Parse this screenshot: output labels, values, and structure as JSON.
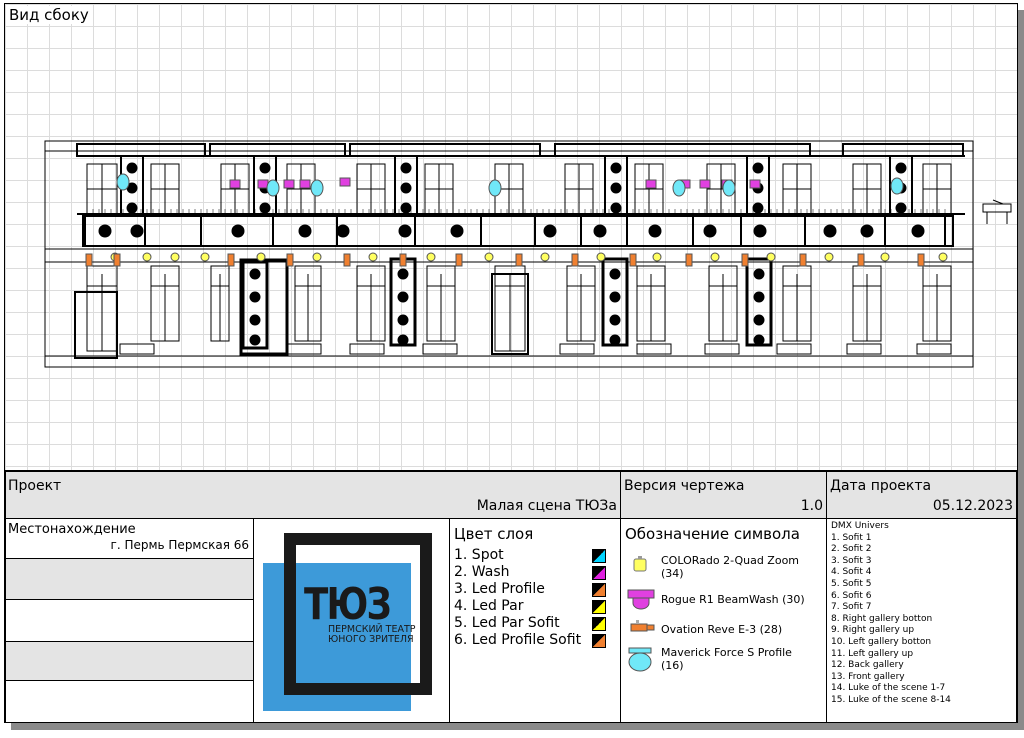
{
  "view_title": "Вид сбоку",
  "title_block": {
    "project_label": "Проект",
    "project_value": "Малая сцена ТЮЗа",
    "version_label": "Версия чертежа",
    "version_value": "1.0",
    "date_label": "Дата проекта",
    "date_value": "05.12.2023",
    "location_label": "Местонахождение",
    "location_value": "г. Пермь Пермская 66"
  },
  "logo": {
    "text": "ТЮЗ",
    "subtitle_line1": "ПЕРМСКИЙ ТЕАТР",
    "subtitle_line2": "ЮНОГО ЗРИТЕЛЯ",
    "blue": "#3d9ad9"
  },
  "layers": {
    "title": "Цвет слоя",
    "items": [
      {
        "label": "1. Spot",
        "color": "#00d4ff"
      },
      {
        "label": "2. Wash",
        "color": "#e020e0"
      },
      {
        "label": "3. Led Profile",
        "color": "#f08030"
      },
      {
        "label": "4. Led Par",
        "color": "#ffff00"
      },
      {
        "label": "5. Led Par Sofit",
        "color": "#ffff00"
      },
      {
        "label": "6. Led Profile Sofit",
        "color": "#f08030"
      }
    ]
  },
  "symbols": {
    "title": "Обозначение символа",
    "items": [
      {
        "label": "COLORado 2-Quad Zoom (34)",
        "icon": "led-par-icon",
        "color": "#ffff60"
      },
      {
        "label": "Rogue R1 BeamWash (30)",
        "icon": "beamwash-icon",
        "color": "#e040e0"
      },
      {
        "label": "Ovation Reve E-3 (28)",
        "icon": "led-profile-icon",
        "color": "#f08030"
      },
      {
        "label": "Maverick Force S Profile (16)",
        "icon": "spot-profile-icon",
        "color": "#70e8f8"
      }
    ]
  },
  "dmx": {
    "title": "DMX Univers",
    "items": [
      "1. Sofit 1",
      "2. Sofit 2",
      "3. Sofit 3",
      "4. Sofit 4",
      "5. Sofit 5",
      "6. Sofit 6",
      "7. Sofit 7",
      "8. Right gallery botton",
      "9. Right gallery up",
      "10. Left gallery botton",
      "11. Left gallery up",
      "12. Back gallery",
      "13. Front gallery",
      "14. Luke of the scene 1-7",
      "15. Luke of the scene 8-14"
    ]
  }
}
